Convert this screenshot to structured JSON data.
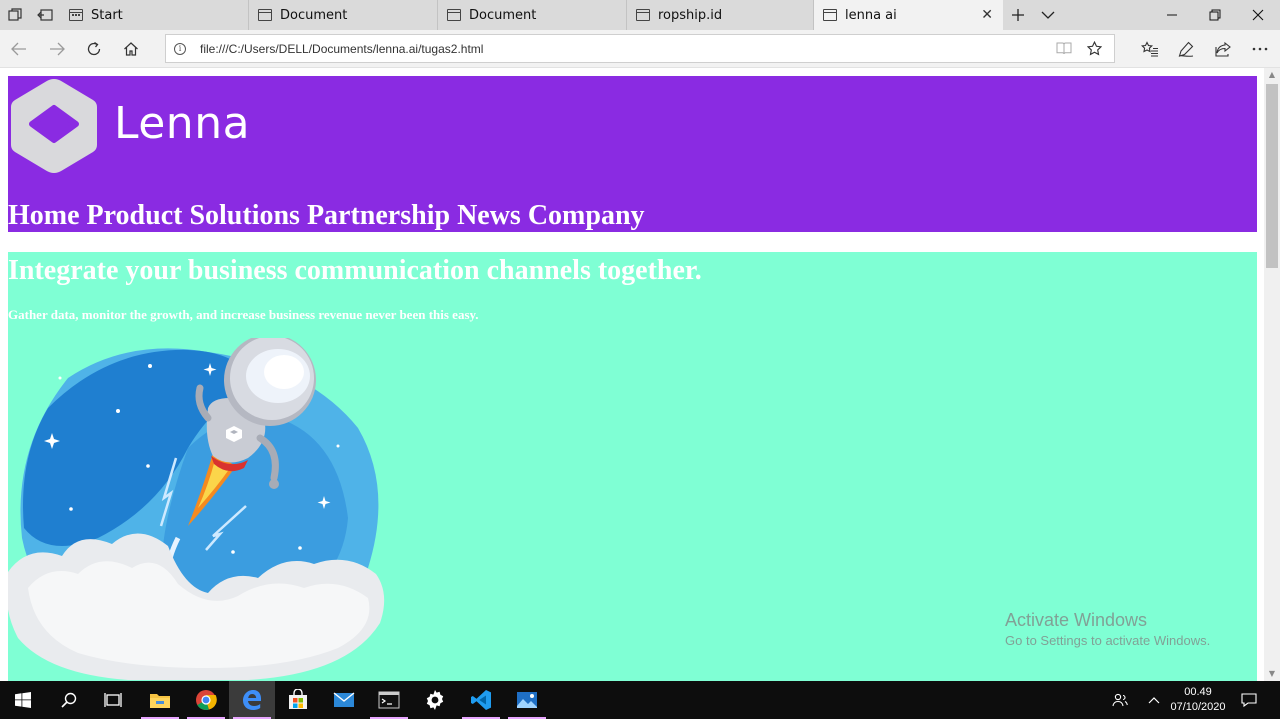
{
  "browser": {
    "tabs": [
      {
        "label": "Start",
        "icon": "start-page-icon",
        "active": false
      },
      {
        "label": "Document",
        "icon": "page-icon",
        "active": false
      },
      {
        "label": "Document",
        "icon": "page-icon",
        "active": false
      },
      {
        "label": "ropship.id",
        "icon": "page-icon",
        "active": false
      },
      {
        "label": "lenna ai",
        "icon": "page-icon",
        "active": true
      }
    ],
    "address": "file:///C:/Users/DELL/Documents/lenna.ai/tugas2.html"
  },
  "page": {
    "logo_text": "Lenna",
    "nav": [
      "Home",
      "Product",
      "Solutions",
      "Partnership",
      "News",
      "Company"
    ],
    "hero_title": "Integrate your business communication channels together.",
    "hero_subtitle": "Gather data, monitor the growth, and increase business revenue never been this easy.",
    "colors": {
      "header_bg": "#8a2be2",
      "hero_bg": "#7fffd4",
      "text": "#ffffff"
    }
  },
  "watermark": {
    "title": "Activate Windows",
    "subtitle": "Go to Settings to activate Windows."
  },
  "taskbar": {
    "apps": [
      "start-icon",
      "search-icon",
      "task-view-icon",
      "file-explorer-icon",
      "chrome-icon",
      "edge-icon",
      "store-icon",
      "mail-icon",
      "terminal-icon",
      "settings-icon",
      "vscode-icon",
      "photos-icon"
    ],
    "time": "00.49",
    "date": "07/10/2020"
  }
}
